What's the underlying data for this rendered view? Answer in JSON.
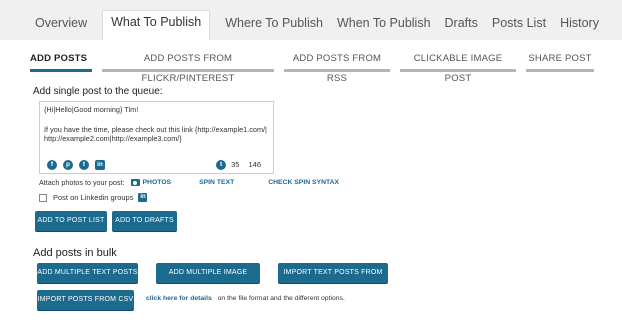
{
  "top_tabs": [
    "Overview",
    "What To Publish",
    "Where To Publish",
    "When To Publish",
    "Drafts",
    "Posts List",
    "History"
  ],
  "active_top_tab": "What To Publish",
  "sub_tabs": [
    "ADD POSTS",
    "ADD POSTS FROM FLICKR/PINTEREST",
    "ADD POSTS FROM RSS",
    "CLICKABLE IMAGE POST",
    "SHARE POST"
  ],
  "single": {
    "heading": "Add single post to the queue:",
    "textarea_lines": [
      "{Hi|Hello|Good morning} Tim!",
      "",
      "If you have the time, please check out this link {http://example1.com/|",
      "http://example2.com|http://example3.com/}"
    ],
    "social_icons": [
      "facebook-icon",
      "pinterest-icon",
      "twitter-icon",
      "linkedin-icon"
    ],
    "twitter_count": "35",
    "char_count": "146",
    "attach_label": "Attach photos to your post:",
    "photos_link": "PHOTOS",
    "spin_text_link": "SPIN TEXT",
    "check_spin_link": "CHECK SPIN SYNTAX",
    "linkedin_groups_label": "Post on Linkedin groups",
    "add_to_post_list": "ADD TO POST LIST",
    "add_to_drafts": "ADD TO DRAFTS"
  },
  "bulk": {
    "heading": "Add posts in bulk",
    "add_multiple_text": "ADD MULTIPLE TEXT POSTS",
    "add_multiple_image": "ADD MULTIPLE IMAGE POSTS",
    "import_text_file": "IMPORT TEXT POSTS FROM FILE",
    "import_csv": "IMPORT POSTS FROM CSV",
    "details_link": "click here for details",
    "details_suffix": "on the file format and the different options."
  },
  "colors": {
    "accent": "#1c6a8e",
    "tab_bar_bg": "#f0f0f0",
    "inactive_underline": "#b4b4b4"
  }
}
